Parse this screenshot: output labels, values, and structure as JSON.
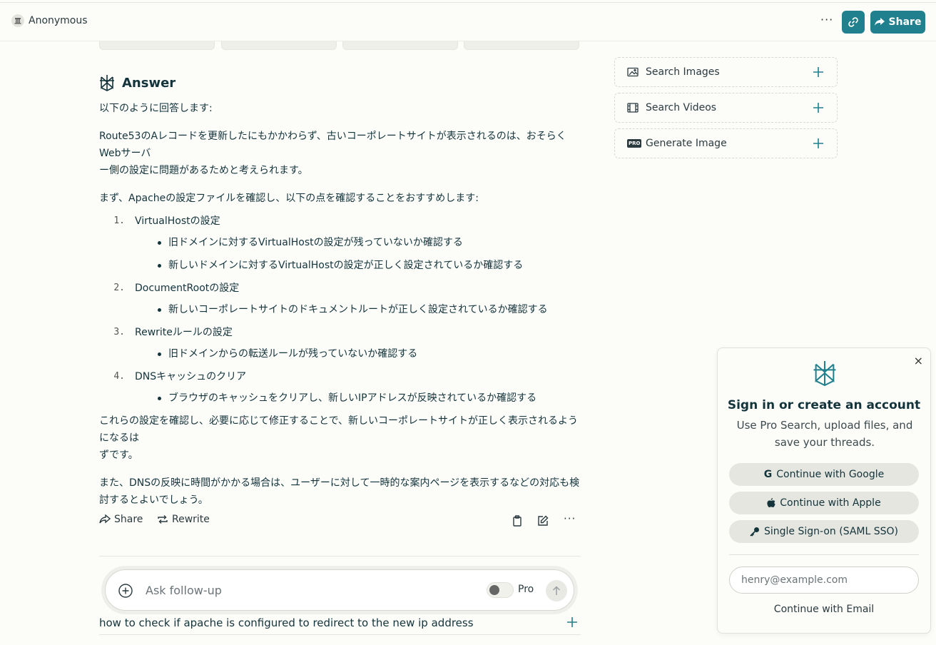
{
  "header": {
    "user_name": "Anonymous",
    "more": "···",
    "share_label": "Share"
  },
  "answer": {
    "title": "Answer",
    "intro": "以下のように回答します:",
    "para1a": "Route53のAレコードを更新したにもかかわらず、古いコーポレートサイトが表示されるのは、おそらくWebサーバ",
    "para1b": "ー側の設定に問題があるためと考えられます。",
    "para2": "まず、Apacheの設定ファイルを確認し、以下の点を確認することをおすすめします:",
    "steps": [
      {
        "num": "1.",
        "label": "VirtualHostの設定",
        "bullets": [
          "旧ドメインに対するVirtualHostの設定が残っていないか確認する",
          "新しいドメインに対するVirtualHostの設定が正しく設定されているか確認する"
        ]
      },
      {
        "num": "2.",
        "label": "DocumentRootの設定",
        "bullets": [
          "新しいコーポレートサイトのドキュメントルートが正しく設定されているか確認する"
        ]
      },
      {
        "num": "3.",
        "label": "Rewriteルールの設定",
        "bullets": [
          "旧ドメインからの転送ルールが残っていないか確認する"
        ]
      },
      {
        "num": "4.",
        "label": "DNSキャッシュのクリア",
        "bullets": [
          "ブラウザのキャッシュをクリアし、新しいIPアドレスが反映されているか確認する"
        ]
      }
    ],
    "para3a": "これらの設定を確認し、必要に応じて修正することで、新しいコーポレートサイトが正しく表示されるようになるは",
    "para3b": "ずです。",
    "para4a": "また、DNSの反映に時間がかかる場合は、ユーザーに対して一時的な案内ページを表示するなどの対応も検",
    "para4b": "討するとよいでしょう。"
  },
  "actions": {
    "share": "Share",
    "rewrite": "Rewrite"
  },
  "followup": {
    "placeholder": "Ask follow-up",
    "pro": "Pro"
  },
  "related": {
    "item1": "how to check if apache is configured to redirect to the new ip address"
  },
  "sidebar": {
    "search_images": "Search Images",
    "search_videos": "Search Videos",
    "generate_image": "Generate Image",
    "pro_badge": "PRO"
  },
  "modal": {
    "close": "×",
    "title": "Sign in or create an account",
    "subtitle": "Use Pro Search, upload files, and save your threads.",
    "google": "Continue with Google",
    "apple": "Continue with Apple",
    "sso": "Single Sign-on (SAML SSO)",
    "email_placeholder": "henry@example.com",
    "email_cta": "Continue with Email"
  },
  "colors": {
    "accent": "#20808d",
    "text": "#13343b",
    "background": "#fcfcf9"
  }
}
